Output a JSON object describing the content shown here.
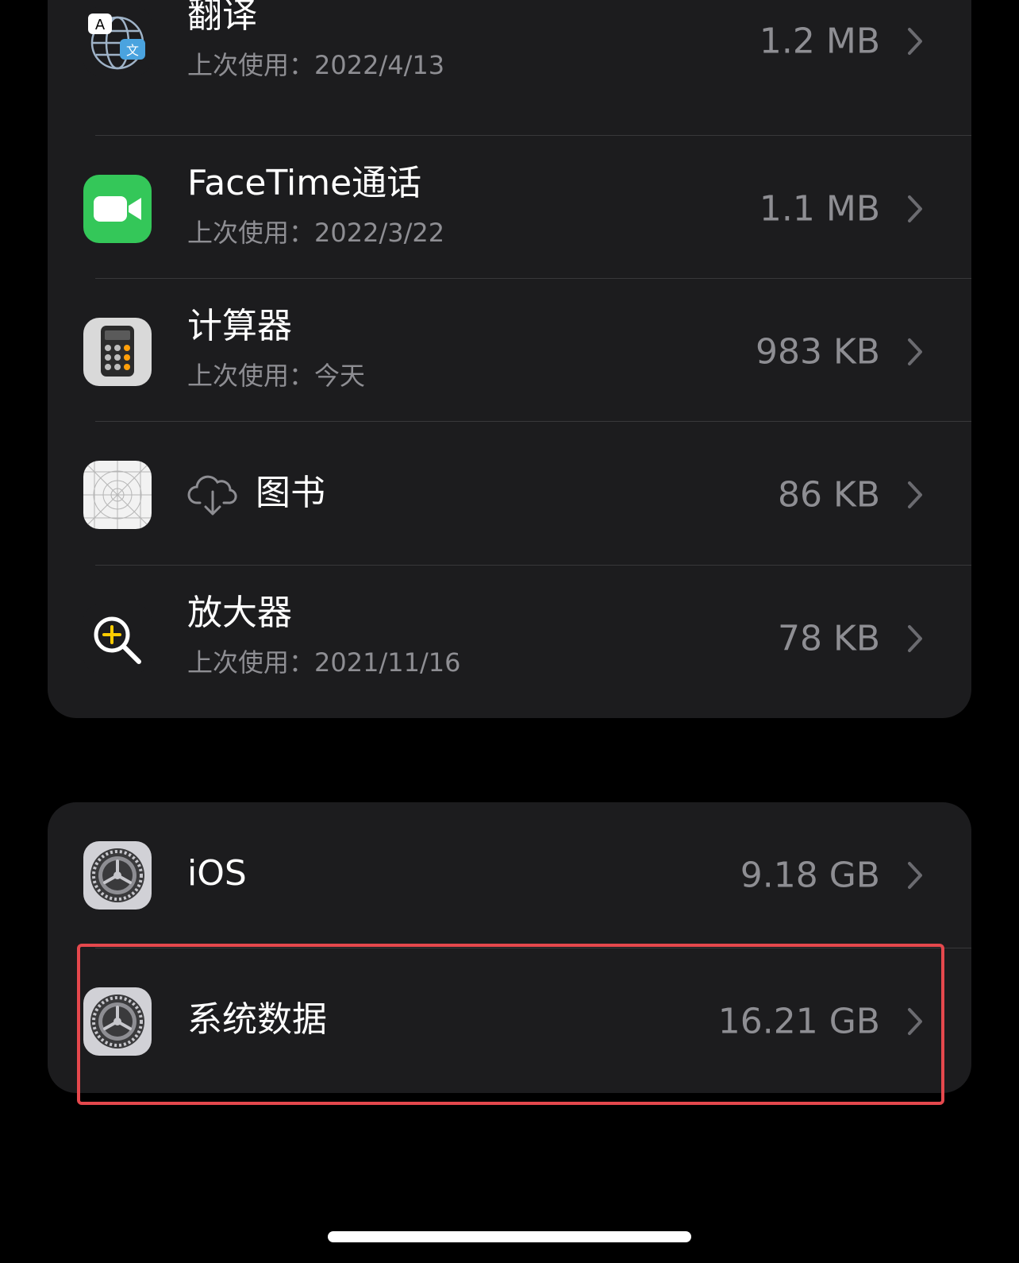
{
  "apps": [
    {
      "id": "translate",
      "name": "翻译",
      "last_used": "上次使用：2022/4/13",
      "size": "1.2 MB",
      "icon": "translate-icon"
    },
    {
      "id": "facetime",
      "name": "FaceTime通话",
      "last_used": "上次使用：2022/3/22",
      "size": "1.1 MB",
      "icon": "facetime-icon"
    },
    {
      "id": "calculator",
      "name": "计算器",
      "last_used": "上次使用：今天",
      "size": "983 KB",
      "icon": "calculator-icon"
    },
    {
      "id": "books",
      "name": "图书",
      "last_used": "",
      "size": "86 KB",
      "icon": "books-placeholder-icon"
    },
    {
      "id": "magnifier",
      "name": "放大器",
      "last_used": "上次使用：2021/11/16",
      "size": "78 KB",
      "icon": "magnifier-icon"
    }
  ],
  "system": [
    {
      "id": "ios",
      "name": "iOS",
      "size": "9.18 GB",
      "icon": "settings-gear-icon"
    },
    {
      "id": "system-data",
      "name": "系统数据",
      "size": "16.21 GB",
      "icon": "settings-gear-icon",
      "highlighted": true
    }
  ],
  "colors": {
    "background": "#000000",
    "card": "#1c1c1e",
    "secondary_text": "#8e8e93",
    "separator": "#38383a",
    "highlight": "#e5484d",
    "facetime_green": "#34c759"
  }
}
